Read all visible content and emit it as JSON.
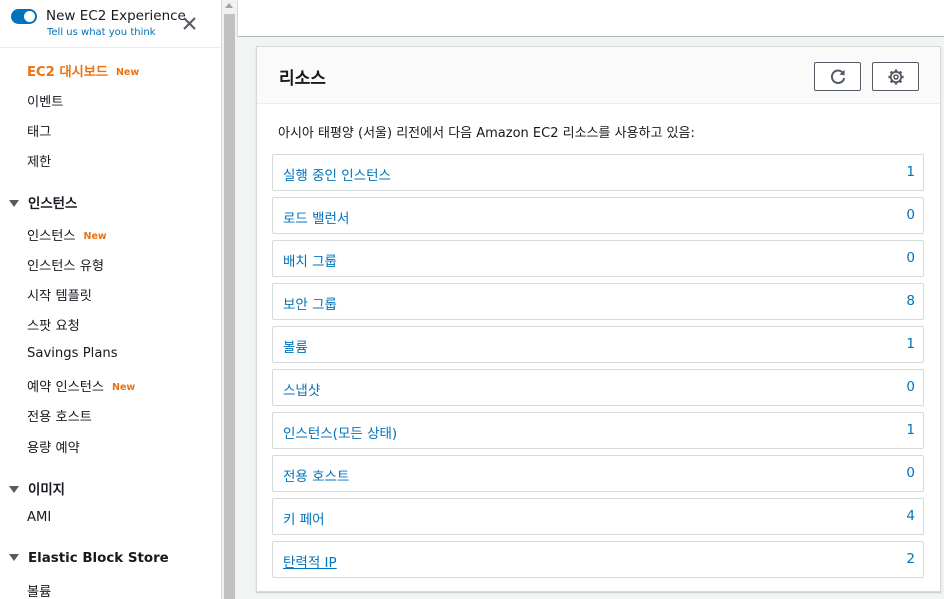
{
  "sidebar": {
    "experience_title": "New EC2 Experience",
    "experience_link": "Tell us what you think",
    "new_badge": "New",
    "items": [
      {
        "label": "EC2 대시보드",
        "badge": "New"
      },
      {
        "label": "이벤트"
      },
      {
        "label": "태그"
      },
      {
        "label": "제한"
      }
    ],
    "sections": {
      "instances": {
        "title": "인스턴스",
        "items": [
          {
            "label": "인스턴스",
            "badge": "New"
          },
          {
            "label": "인스턴스 유형"
          },
          {
            "label": "시작 템플릿"
          },
          {
            "label": "스팟 요청"
          },
          {
            "label": "Savings Plans"
          },
          {
            "label": "예약 인스턴스",
            "badge": "New"
          },
          {
            "label": "전용 호스트"
          },
          {
            "label": "용량 예약"
          }
        ]
      },
      "images": {
        "title": "이미지",
        "items": [
          {
            "label": "AMI"
          }
        ]
      },
      "ebs": {
        "title": "Elastic Block Store",
        "items": [
          {
            "label": "볼륨"
          }
        ]
      }
    }
  },
  "resources": {
    "title": "리소스",
    "description": "아시아 태평양 (서울) 리전에서 다음 Amazon EC2 리소스를 사용하고 있음:",
    "rows": [
      {
        "label": "실행 중인 인스턴스",
        "count": "1"
      },
      {
        "label": "로드 밸런서",
        "count": "0"
      },
      {
        "label": "배치 그룹",
        "count": "0"
      },
      {
        "label": "보안 그룹",
        "count": "8"
      },
      {
        "label": "볼륨",
        "count": "1"
      },
      {
        "label": "스냅샷",
        "count": "0"
      },
      {
        "label": "인스턴스(모든 상태)",
        "count": "1"
      },
      {
        "label": "전용 호스트",
        "count": "0"
      },
      {
        "label": "키 페어",
        "count": "4"
      },
      {
        "label": "탄력적 IP",
        "count": "2"
      }
    ]
  },
  "icons": {
    "toggle": "toggle-switch-on",
    "close": "close-icon",
    "section_caret": "caret-down-icon",
    "refresh": "refresh-icon",
    "settings": "gear-icon"
  },
  "colors": {
    "accent_orange": "#ec7211",
    "link_blue": "#0073bb",
    "toggle_blue": "#0073bb",
    "text": "#16191f",
    "border": "#d5dbdb"
  }
}
